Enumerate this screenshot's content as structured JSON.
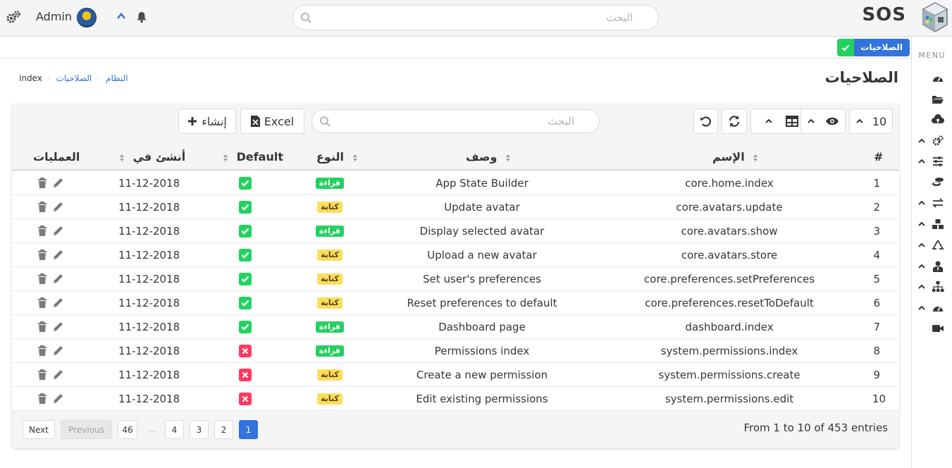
{
  "topbar": {
    "admin_name": "Admin",
    "search_placeholder": "البحث",
    "brand": "SOS"
  },
  "sidebar": {
    "menu_label": "MENU",
    "items": [
      {
        "icon": "dashboard-icon",
        "has_caret": false
      },
      {
        "icon": "folder-open-icon",
        "has_caret": false
      },
      {
        "icon": "cloud-upload-icon",
        "has_caret": false
      },
      {
        "icon": "cogs-icon",
        "has_caret": true
      },
      {
        "icon": "sliders-icon",
        "has_caret": true
      },
      {
        "icon": "coins-icon",
        "has_caret": false
      },
      {
        "icon": "exchange-icon",
        "has_caret": true
      },
      {
        "icon": "boxes-icon",
        "has_caret": true
      },
      {
        "icon": "recycle-icon",
        "has_caret": true
      },
      {
        "icon": "user-tie-icon",
        "has_caret": true
      },
      {
        "icon": "sitemap-icon",
        "has_caret": true
      },
      {
        "icon": "tachometer-icon",
        "has_caret": true
      },
      {
        "icon": "video-icon",
        "has_caret": false
      }
    ]
  },
  "tag": {
    "label": "الصلاحيات"
  },
  "page": {
    "title": "الصلاحيات"
  },
  "breadcrumb": {
    "items": [
      "النظام",
      "الصلاحيات"
    ],
    "current": "index"
  },
  "toolbar": {
    "page_size": "10",
    "excel_label": "Excel",
    "create_label": "إنشاء",
    "search_placeholder": "البحث"
  },
  "table": {
    "headers": {
      "index": "#",
      "name": "الإسم",
      "description": "وصف",
      "type": "النوع",
      "default": "Default",
      "created_at": "أنشئ في",
      "actions": "العمليات"
    },
    "type_labels": {
      "read": "قراءة",
      "write": "كتابة"
    },
    "rows": [
      {
        "index": "1",
        "name": "core.home.index",
        "description": "App State Builder",
        "type": "read",
        "default": true,
        "created_at": "11-12-2018"
      },
      {
        "index": "2",
        "name": "core.avatars.update",
        "description": "Update avatar",
        "type": "write",
        "default": true,
        "created_at": "11-12-2018"
      },
      {
        "index": "3",
        "name": "core.avatars.show",
        "description": "Display selected avatar",
        "type": "read",
        "default": true,
        "created_at": "11-12-2018"
      },
      {
        "index": "4",
        "name": "core.avatars.store",
        "description": "Upload a new avatar",
        "type": "write",
        "default": true,
        "created_at": "11-12-2018"
      },
      {
        "index": "5",
        "name": "core.preferences.setPreferences",
        "description": "Set user's preferences",
        "type": "write",
        "default": true,
        "created_at": "11-12-2018"
      },
      {
        "index": "6",
        "name": "core.preferences.resetToDefault",
        "description": "Reset preferences to default",
        "type": "write",
        "default": true,
        "created_at": "11-12-2018"
      },
      {
        "index": "7",
        "name": "dashboard.index",
        "description": "Dashboard page",
        "type": "read",
        "default": true,
        "created_at": "11-12-2018"
      },
      {
        "index": "8",
        "name": "system.permissions.index",
        "description": "Permissions index",
        "type": "read",
        "default": false,
        "created_at": "11-12-2018"
      },
      {
        "index": "9",
        "name": "system.permissions.create",
        "description": "Create a new permission",
        "type": "write",
        "default": false,
        "created_at": "11-12-2018"
      },
      {
        "index": "10",
        "name": "system.permissions.edit",
        "description": "Edit existing permissions",
        "type": "write",
        "default": false,
        "created_at": "11-12-2018"
      }
    ]
  },
  "pagination": {
    "info": "From 1 to 10 of 453 entries",
    "next_label": "Next",
    "previous_label": "Previous",
    "pages": [
      "46",
      "4",
      "3",
      "2",
      "1"
    ],
    "ellipsis": "...",
    "current": "1"
  },
  "colors": {
    "read": "#23d160",
    "write": "#ffdd57",
    "on": "#23d160",
    "off": "#ff3860",
    "accent": "#3273dc"
  }
}
